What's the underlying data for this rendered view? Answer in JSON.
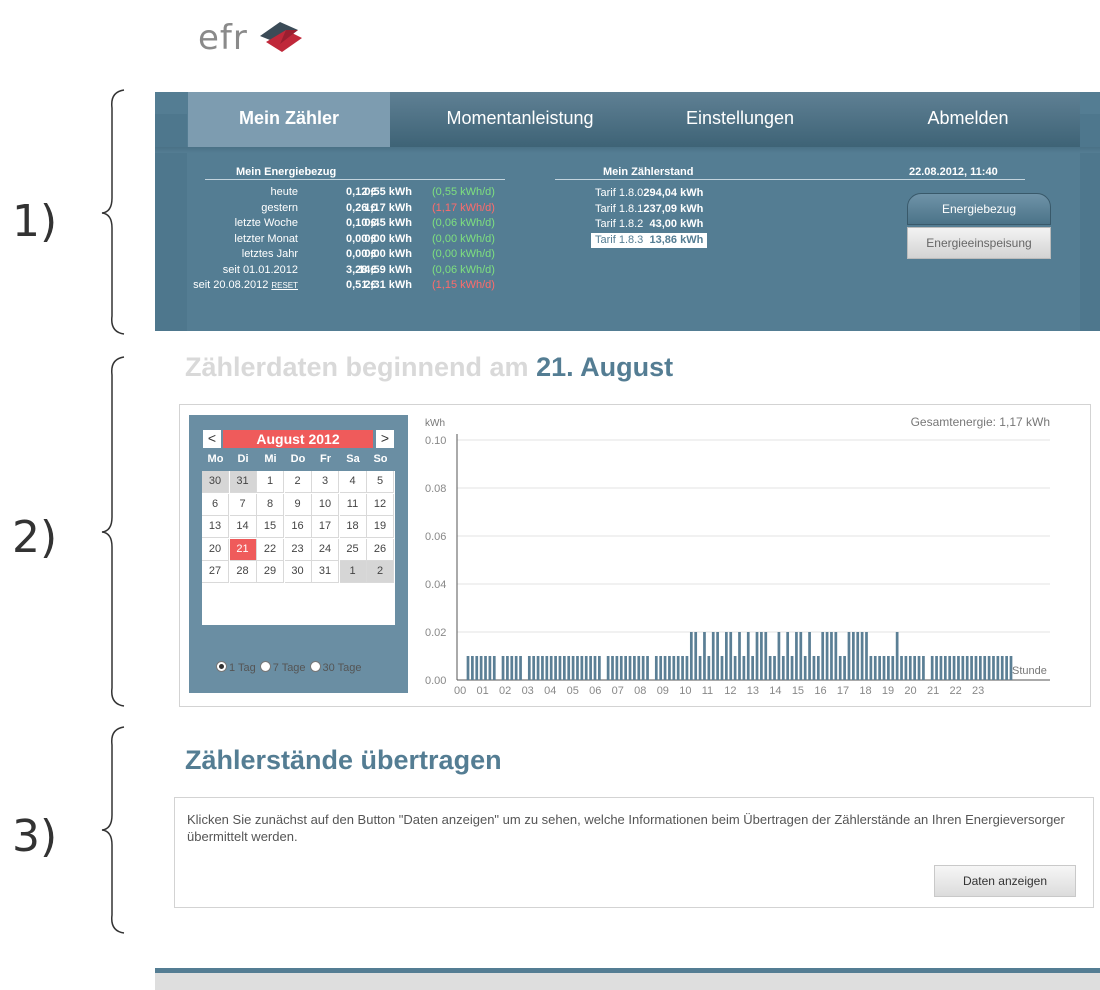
{
  "brand": {
    "logo_text": "efr",
    "colors": {
      "primary": "#547d93",
      "accent_red": "#ef5b5b",
      "positive": "#7ee07e",
      "negative": "#ff6b6b"
    }
  },
  "annotations": {
    "sections": [
      "1)",
      "2)",
      "3)"
    ]
  },
  "nav": {
    "tabs": [
      {
        "label": "Mein Zähler",
        "active": true
      },
      {
        "label": "Momentanleistung",
        "active": false
      },
      {
        "label": "Einstellungen",
        "active": false
      },
      {
        "label": "Abmelden",
        "active": false
      }
    ]
  },
  "energy": {
    "heading": "Mein Energiebezug",
    "rows": [
      {
        "label": "heute",
        "reset": "",
        "eur": "0,12 €",
        "kwh": "0,55 kWh",
        "rate": "(0,55 kWh/d)",
        "status": "positive"
      },
      {
        "label": "gestern",
        "reset": "",
        "eur": "0,26 €",
        "kwh": "1,17 kWh",
        "rate": "(1,17 kWh/d)",
        "status": "negative"
      },
      {
        "label": "letzte Woche",
        "reset": "",
        "eur": "0,10 €",
        "kwh": "0,45 kWh",
        "rate": "(0,06 kWh/d)",
        "status": "positive"
      },
      {
        "label": "letzter Monat",
        "reset": "",
        "eur": "0,00 €",
        "kwh": "0,00 kWh",
        "rate": "(0,00 kWh/d)",
        "status": "positive"
      },
      {
        "label": "letztes Jahr",
        "reset": "",
        "eur": "0,00 €",
        "kwh": "0,00 kWh",
        "rate": "(0,00 kWh/d)",
        "status": "positive"
      },
      {
        "label": "seit 01.01.2012",
        "reset": "",
        "eur": "3,28 €",
        "kwh": "14,59 kWh",
        "rate": "(0,06 kWh/d)",
        "status": "positive"
      },
      {
        "label": "seit 20.08.2012",
        "reset": "RESET",
        "eur": "0,51 €",
        "kwh": "2,31 kWh",
        "rate": "(1,15 kWh/d)",
        "status": "negative"
      }
    ]
  },
  "meter": {
    "heading": "Mein Zählerstand",
    "rows": [
      {
        "label": "Tarif 1.8.0",
        "value": "294,04 kWh",
        "selected": false
      },
      {
        "label": "Tarif 1.8.1",
        "value": "237,09 kWh",
        "selected": false
      },
      {
        "label": "Tarif 1.8.2",
        "value": "43,00 kWh",
        "selected": false
      },
      {
        "label": "Tarif 1.8.3",
        "value": "13,86 kWh",
        "selected": true
      }
    ]
  },
  "status": {
    "datetime": "22.08.2012, 11:40",
    "btn_consumption": "Energiebezug",
    "btn_feedin": "Energieeinspeisung"
  },
  "section2": {
    "title_prefix": "Zählerdaten beginnend am",
    "title_date": "21. August"
  },
  "calendar": {
    "month_label": "August 2012",
    "prev": "<",
    "next": ">",
    "weekdays": [
      "Mo",
      "Di",
      "Mi",
      "Do",
      "Fr",
      "Sa",
      "So"
    ],
    "weeks": [
      [
        "30",
        "31",
        "1",
        "2",
        "3",
        "4",
        "5"
      ],
      [
        "6",
        "7",
        "8",
        "9",
        "10",
        "11",
        "12"
      ],
      [
        "13",
        "14",
        "15",
        "16",
        "17",
        "18",
        "19"
      ],
      [
        "20",
        "21",
        "22",
        "23",
        "24",
        "25",
        "26"
      ],
      [
        "27",
        "28",
        "29",
        "30",
        "31",
        "1",
        "2"
      ]
    ],
    "other_month": [
      [
        0,
        0
      ],
      [
        0,
        1
      ],
      [
        4,
        5
      ],
      [
        4,
        6
      ]
    ],
    "selected": [
      3,
      1
    ],
    "ranges": [
      {
        "label": "1 Tag",
        "checked": true
      },
      {
        "label": "7 Tage",
        "checked": false
      },
      {
        "label": "30 Tage",
        "checked": false
      }
    ]
  },
  "chart_data": {
    "type": "bar",
    "title": "Gesamtenergie: 1,17 kWh",
    "ylabel": "kWh",
    "xlabel": "Stunde",
    "ylim": [
      0,
      0.1
    ],
    "yticks": [
      "0.00",
      "0.02",
      "0.04",
      "0.06",
      "0.08",
      "0.10"
    ],
    "xticks": [
      "00",
      "01",
      "02",
      "03",
      "04",
      "05",
      "06",
      "07",
      "08",
      "09",
      "10",
      "11",
      "12",
      "13",
      "14",
      "15",
      "16",
      "17",
      "18",
      "19",
      "20",
      "21",
      "22",
      "23"
    ],
    "values": [
      0.01,
      0.01,
      0.01,
      0.01,
      0.01,
      0.01,
      0.01,
      0,
      0.01,
      0.01,
      0.01,
      0.01,
      0.01,
      0,
      0.01,
      0.01,
      0.01,
      0.01,
      0.01,
      0.01,
      0.01,
      0.01,
      0.01,
      0.01,
      0.01,
      0.01,
      0.01,
      0.01,
      0.01,
      0.01,
      0.01,
      0,
      0.01,
      0.01,
      0.01,
      0.01,
      0.01,
      0.01,
      0.01,
      0.01,
      0.01,
      0.01,
      0,
      0.01,
      0.01,
      0.01,
      0.01,
      0.01,
      0.01,
      0.01,
      0.01,
      0.02,
      0.02,
      0.01,
      0.02,
      0.01,
      0.02,
      0.02,
      0.01,
      0.02,
      0.02,
      0.01,
      0.02,
      0.01,
      0.02,
      0.01,
      0.02,
      0.02,
      0.02,
      0.01,
      0.01,
      0.02,
      0.01,
      0.02,
      0.01,
      0.02,
      0.02,
      0.01,
      0.02,
      0.01,
      0.01,
      0.02,
      0.02,
      0.02,
      0.02,
      0.01,
      0.01,
      0.02,
      0.02,
      0.02,
      0.02,
      0.02,
      0.01,
      0.01,
      0.01,
      0.01,
      0.01,
      0.01,
      0.02,
      0.01,
      0.01,
      0.01,
      0.01,
      0.01,
      0.01,
      0,
      0.01,
      0.01,
      0.01,
      0.01,
      0.01,
      0.01,
      0.01,
      0.01,
      0.01,
      0.01,
      0.01,
      0.01,
      0.01,
      0.01,
      0.01,
      0.01,
      0.01,
      0.01,
      0.01
    ]
  },
  "section3": {
    "title": "Zählerstände übertragen",
    "description": "Klicken Sie zunächst auf den Button \"Daten anzeigen\" um zu sehen, welche Informationen beim Übertragen der Zählerstände an Ihren Energieversorger übermittelt werden.",
    "button": "Daten anzeigen"
  }
}
